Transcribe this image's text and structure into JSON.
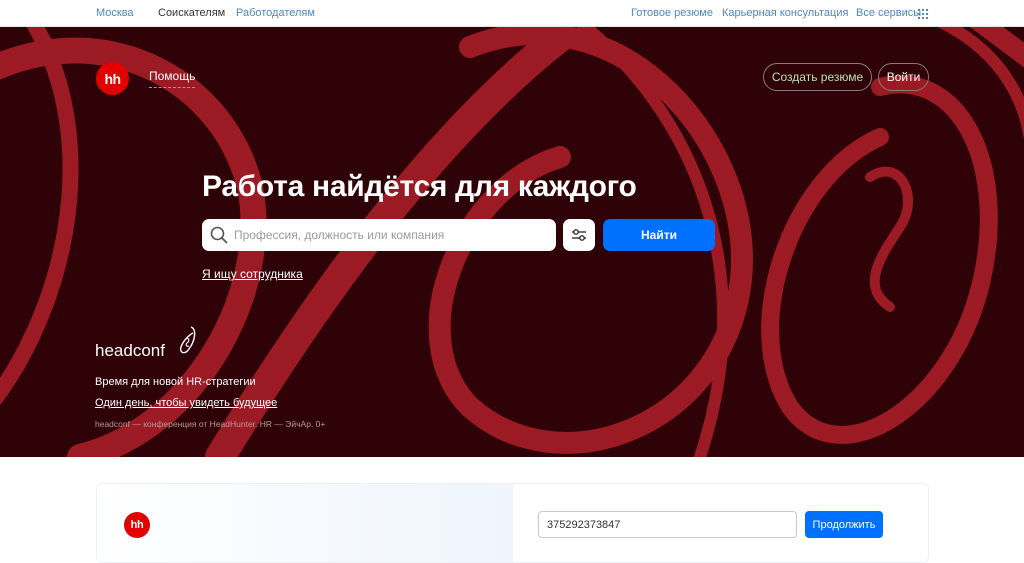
{
  "topbar": {
    "city": "Москва",
    "seekers": "Соискателям",
    "employers": "Работодателям",
    "ready_resume": "Готовое резюме",
    "career": "Карьерная консультация",
    "all_services": "Все сервисы"
  },
  "header": {
    "logo": "hh",
    "help": "Помощь",
    "create_resume": "Создать резюме",
    "login": "Войти"
  },
  "hero": {
    "title": "Работа найдётся для каждого",
    "search_placeholder": "Профессия, должность или компания",
    "find": "Найти",
    "employer_link": "Я ищу сотрудника"
  },
  "conference": {
    "brand": "headconf",
    "line1": "Время для новой HR-стратегии",
    "line2": "Один день, чтобы увидеть будущее",
    "note": "headconf — конференция от HeadHunter. HR — ЭйчАр. 0+"
  },
  "login_card": {
    "logo": "hh",
    "phone_value": "375292373847",
    "continue": "Продолжить"
  },
  "colors": {
    "hero_bg": "#2e0206",
    "hero_swirl": "#9b1a24",
    "accent_blue": "#0070ff",
    "brand_red": "#e30000",
    "link_blue": "#4f86c6"
  }
}
